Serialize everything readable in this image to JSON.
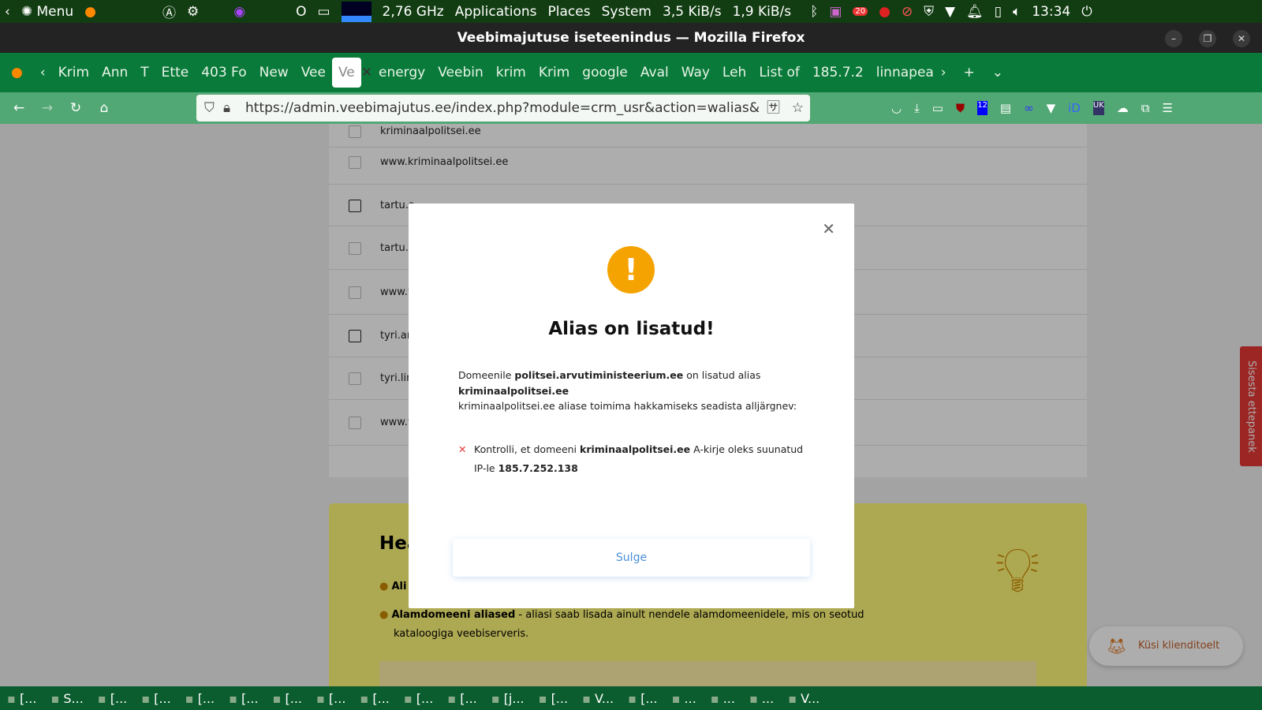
{
  "panel": {
    "menu": "Menu",
    "cpu": "2,76 GHz",
    "applications": "Applications",
    "places": "Places",
    "system": "System",
    "net": "3,5 KiB/s",
    "net_up": "1,9 KiB/s",
    "badge": "20",
    "clock": "13:34"
  },
  "window": {
    "title": "Veebimajutuse iseteenindus — Mozilla Firefox"
  },
  "tabs": [
    "Krim",
    "Ann",
    "T",
    "Ette",
    "403 Fo",
    "New",
    "Vee",
    "Ve",
    "energy",
    "Veebin",
    "krim",
    "Krim",
    "google",
    "Aval",
    "Way",
    "Leh",
    "List of",
    "185.7.2",
    "linnapea"
  ],
  "url": "https://admin.veebimajutus.ee/index.php?module=crm_usr&action=walias&",
  "toolbar": {
    "badge_12": "12",
    "badge_uk": "UK"
  },
  "list": [
    "kriminaalpolitsei.ee",
    "www.kriminaalpolitsei.ee",
    "tartu.a",
    "tartu.l",
    "www.t",
    "tyri.ar",
    "tyri.lin",
    "www.t"
  ],
  "help": {
    "title": "Hea",
    "bullet1": "Ali",
    "bullet2_bold": "Alamdomeeni aliased",
    "bullet2": " - aliasi saab lisada ainult nendele alamdomeenidele, mis on seotud kataloogiga veebiserveris."
  },
  "modal": {
    "title": "Alias on lisatud!",
    "p1_a": "Domeenile ",
    "p1_domain": "politsei.arvutiministeerium.ee",
    "p1_b": " on lisatud alias",
    "p1_alias": "kriminaalpolitsei.ee",
    "p2": "kriminaalpolitsei.ee aliase toimima hakkamiseks seadista alljärgnev:",
    "check_a": "Kontrolli, et domeeni ",
    "check_domain": "kriminaalpolitsei.ee",
    "check_b": " A-kirje oleks suunatud",
    "check_c": "IP-le ",
    "check_ip": "185.7.252.138",
    "close": "Sulge"
  },
  "feedback": "Sisesta ettepanek",
  "chat": "Küsi klienditoelt",
  "taskbar": [
    "[...",
    "S...",
    "[...",
    "[...",
    "[...",
    "[...",
    "[...",
    "[...",
    "[...",
    "[...",
    "[...",
    "[j...",
    "[...",
    "V...",
    "[...",
    "...",
    "...",
    "...",
    "V..."
  ],
  "colors": {
    "warning": "#f5a300",
    "accent": "#4a90d9",
    "tab_green": "#0a7a3a",
    "error": "#e53935"
  }
}
